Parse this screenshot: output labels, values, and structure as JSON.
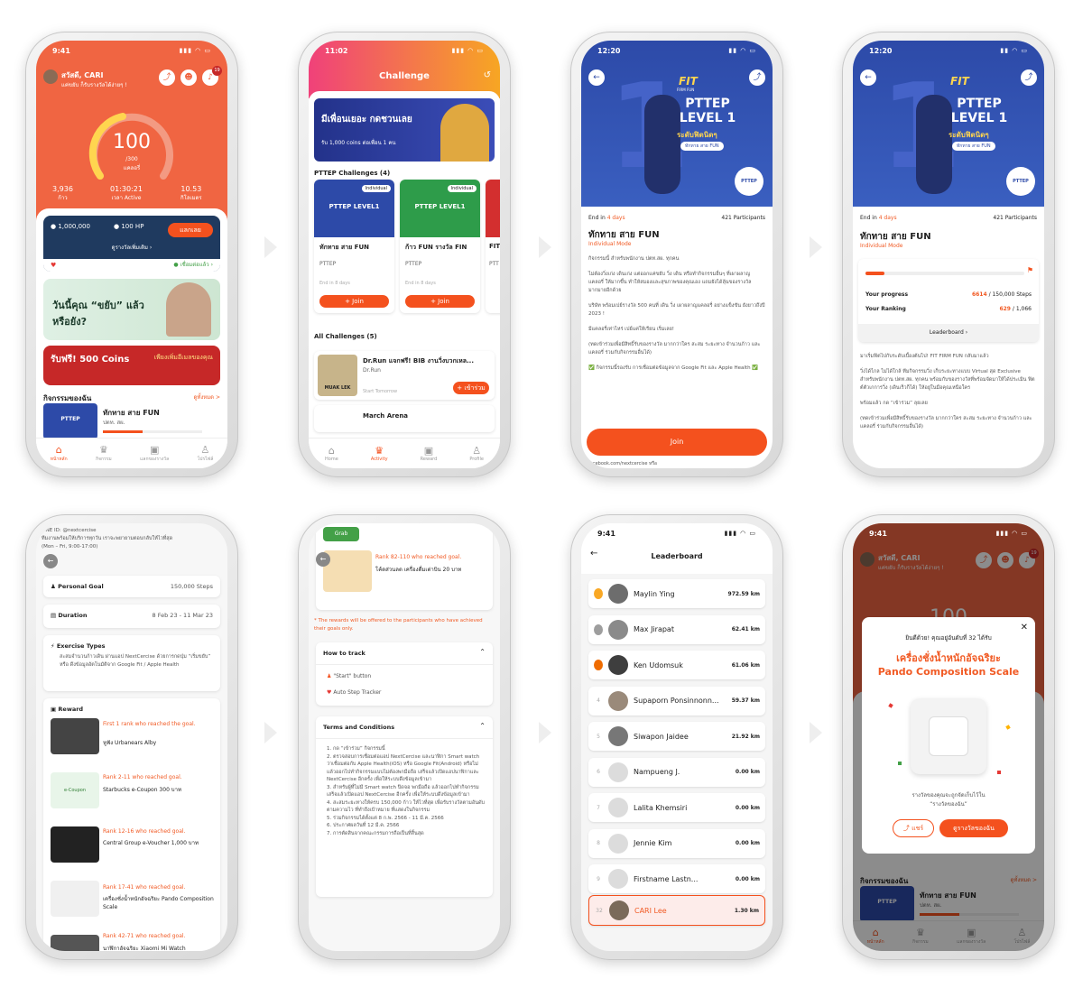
{
  "p1": {
    "time": "9:41",
    "greet": "สวัสดี, CARI",
    "sub": "แค่ขยับ ก็รับรางวัลได้ง่ายๆ !",
    "badge": "19",
    "kcal": "100",
    "kcal_of": "/300",
    "kcal_unit": "แคลอรี่",
    "steps": "3,936",
    "steps_l": "ก้าว",
    "active": "01:30:21",
    "active_l": "เวลา Active",
    "dist": "10.53",
    "dist_l": "กิโลเมตร",
    "coins": "1,000,000",
    "hp": "100 HP",
    "redeem": "แลกเลย",
    "reward_link": "ดูรางวัลเพิ่มเติม",
    "connected": "เชื่อมต่อแล้ว",
    "promo1": "วันนี้คุณ “ขยับ” แล้วหรือยัง?",
    "promo2": "รับฟรี! 500 Coins",
    "promo2b": "เพียงเพิ่มอีเมลของคุณ",
    "my_act": "กิจกรรมของฉัน",
    "see_all": "ดูทั้งหมด >",
    "act_title": "ทักทาย สาย FUN",
    "act_org": "ปตท. สผ.",
    "nav": [
      "หน้าหลัก",
      "กิจกรรม",
      "แลกของรางวัล",
      "โปรไฟล์"
    ]
  },
  "p2": {
    "time": "11:02",
    "title": "Challenge",
    "banner": "มีเพื่อนเยอะ กดชวนเลย",
    "banner_sub": "รับ 1,000 coins ต่อเพื่อน 1 คน",
    "pttep_ch": "PTTEP Challenges (4)",
    "c1": {
      "tag": "Individual",
      "title": "ทักทาย สาย FUN",
      "org": "PTTEP",
      "end": "End in 8 days",
      "btn": "+ Join"
    },
    "c2": {
      "tag": "Individual",
      "title": "ก้าว FUN รางวัล FIN",
      "org": "PTTEP",
      "end": "End in 8 days",
      "btn": "+ Join"
    },
    "c3": {
      "title": "FIT",
      "org": "PTT"
    },
    "all_ch": "All Challenges (5)",
    "a1": {
      "title": "Dr.Run แจกฟรี! BIB งานวิ่งบวกเหล...",
      "org": "Dr.Run",
      "when": "Start Tomorrow",
      "btn": "+ เข้าร่วม",
      "img": "MUAK LEK"
    },
    "a2": {
      "title": "March Arena"
    },
    "nav": [
      "Home",
      "Activity",
      "Reward",
      "Profile"
    ]
  },
  "p3": {
    "time": "12:20",
    "fit": "FIT",
    "fit_sub": "FIRM FUN",
    "level": "PTTEP LEVEL 1",
    "lv_th": "ระดับฟิตนิดๆ",
    "pill": "ทักทาย สาย FUN",
    "logo": "PTTEP",
    "end_pre": "End in",
    "end": "4 days",
    "parts": "421 Participants",
    "title": "ทักทาย สาย FUN",
    "mode": "Individual Mode",
    "body": [
      "กิจกรรมนี้ สำหรับพนักงาน ปตท.สผ. ทุกคน",
      "ไม่ต้องวิ่งเก่ง เดินเก่ง แต่ออกแค่ขยับ วิ่ง เดิน หรือทำกิจกรรมอื่นๆ ที่เผาผลาญแคลอรี่ ให้มากขึ้น ทำให้สมองและสุขภาพของคุณเอง แถมยังได้ลุ้นของรางวัลมากมายอีกด้วย",
      "บริษัท พร้อมเปย์รางวัล 500 คนที่ เดิน วิ่ง เผาผลาญแคลอรี่ อย่างแข็งขัน ยังยาวถึงปี 2023 !",
      "มีแคลอรี่เท่าไหร่ เปย์แค่ให้เรียน เริ่มเลย!",
      "(ทดเข้าร่วมเพื่อมีสิทธิ์รับของรางวัล มากกว่าใคร สะสม ระยะทาง จำนวนก้าว และแคลอรี่ ร่วมกับกิจกรรมอื่นได้)",
      "✅ กิจกรรมนี้รองรับ การเชื่อมต่อข้อมูลจาก Google Fit และ Apple Health ✅"
    ],
    "join": "Join",
    "foot": "facebook.com/nextcercise หรือ"
  },
  "p4": {
    "time": "12:20",
    "end_pre": "End in",
    "end": "4 days",
    "parts": "421 Participants",
    "title": "ทักทาย สาย FUN",
    "mode": "Individual Mode",
    "prog_l": "Your progress",
    "prog": "6614",
    "prog_of": "/ 150,000 Steps",
    "rank_l": "Your Ranking",
    "rank": "629",
    "rank_of": "/ 1,066",
    "lb": "Leaderboard",
    "body": [
      "มาเริ่มฟิตไปกับระดับเบื้องต้นไป! FIT FIRM FUN กลับมาแล้ว",
      "วิ่งได้ไกล ไม่ได้ใกล้ ทีมกิจกรรมวิ่ง เก็บระยะทางแบบ Virtual สุด Exclusive สำหรับพนักงาน ปตท.สผ. ทุกคน พร้อมกับของรางวัลที่พร้อมจัดมาให้ได้ประเมิน ฟิตต์ตัวเกการวิ่ง (เดินเร็วก็ได้) ให้อยู่ในมือคุณเหนือใคร",
      "พร้อมแล้ว กด “เข้าร่วม” ลุยเลย",
      "(ทดเข้าร่วมเพื่อมีสิทธิ์รับของรางวัล มากกว่าใคร สะสม ระยะทาง จำนวนก้าว และแคลอรี่ ร่วมกับกิจกรรมอื่นได้)"
    ]
  },
  "p5": {
    "top": [
      "LINE ID: @nextcercise",
      "ทีมงานพร้อมให้บริการทุกวัน เราจะพยายามตอบกลับให้ไวที่สุด",
      "(Mon – Fri, 9:00-17:00)"
    ],
    "goal_l": "Personal Goal",
    "goal": "150,000 Steps",
    "dur_l": "Duration",
    "dur": "8 Feb 23 - 11 Mar 23",
    "ex_l": "Exercise Types",
    "ex": "สะสมจำนวนก้าวเดิน ผ่านแอป NextCercise ด้วยการกดปุ่ม “เริ่มขยับ” หรือ ดึงข้อมูลอัตโนมัติจาก Google Fit / Apple Health",
    "rw_l": "Reward",
    "r1": {
      "rank": "First 1 rank who reached the goal.",
      "prize": "หูฟัง Urbanears Alby"
    },
    "r2": {
      "rank": "Rank 2-11 who reached goal.",
      "prize": "Starbucks e-Coupon 300 บาท",
      "img": "e-Coupon"
    },
    "r3": {
      "rank": "Rank 12-16 who reached goal.",
      "prize": "Central Group e-Voucher 1,000 บาท"
    },
    "r4": {
      "rank": "Rank 17-41 who reached goal.",
      "prize": "เครื่องชั่งน้ำหนักอัจฉริยะ Pando Composition Scale"
    },
    "r5": {
      "rank": "Rank 42-71 who reached goal.",
      "prize": "นาฬิกาอัจฉริยะ Xiaomi Mi Watch"
    }
  },
  "p6": {
    "grab": "Grab",
    "rank": "Rank 82-110 who reached goal.",
    "prize": "โค้ดส่วนลด เครื่องดื่มเต่าบิน 20 บาท",
    "note": "* The rewards will be offered to the participants who have achieved their goals only.",
    "how": "How to track",
    "h1": "\"Start\" button",
    "h2": "Auto Step Tracker",
    "terms": "Terms and Conditions",
    "tlist": [
      "1. กด “เข้าร่วม” กิจกรรมนี้",
      "2. ตรวจสอบการเชื่อมต่อแอป NextCercise และนาฬิกา Smart watch ว่าเชื่อมต่อกับ Apple Health(iOS) หรือ Google Fit(Android) หรือไม่ แล้วออกไปทำกิจกรรมแบบไม่ต้องพกมือถือ เสร็จแล้วเปิดแอปนาฬิกาและ NextCercise อีกครั้ง เพื่อให้ระบบดึงข้อมูลเข้ามา",
      "3. สำหรับผู้ที่ไม่มี Smart watch ปิดจอ พกมือถือ แล้วออกไปทำกิจกรรม เสร็จแล้วเปิดแอป NextCercise อีกครั้ง เพื่อให้ระบบดึงข้อมูลเข้ามา",
      "4. สะสมระยะทางให้ครบ 150,000 ก้าว ให้ไวที่สุด เพื่อรับรางวัลตามอันดับตามความไว ที่ทำถึงเป้าหมาย ที่แสดงในกิจกรรม",
      "5. ร่วมกิจกรรมได้ตั้งแต่ 8 ก.พ. 2566 - 11 มี.ค. 2566",
      "6. ประกาศผลวันที่ 12 มี.ค. 2566",
      "7. การตัดสินจากคณะกรรมการถือเป็นที่สิ้นสุด"
    ]
  },
  "p7": {
    "time": "9:41",
    "title": "Leaderboard",
    "rows": [
      {
        "rank": "1",
        "name": "Maylin Ying",
        "km": "972.59 km"
      },
      {
        "rank": "2",
        "name": "Max Jirapat",
        "km": "62.41 km"
      },
      {
        "rank": "3",
        "name": "Ken Udomsuk",
        "km": "61.06 km"
      },
      {
        "rank": "4",
        "name": "Supaporn Ponsinnonn...",
        "km": "59.37 km"
      },
      {
        "rank": "5",
        "name": "Siwapon Jaidee",
        "km": "21.92 km"
      },
      {
        "rank": "6",
        "name": "Nampueng J.",
        "km": "0.00 km"
      },
      {
        "rank": "7",
        "name": "Lalita Khemsiri",
        "km": "0.00 km"
      },
      {
        "rank": "8",
        "name": "Jennie Kim",
        "km": "0.00 km"
      },
      {
        "rank": "9",
        "name": "Firstname Lastn...",
        "km": "0.00 km"
      }
    ],
    "me": {
      "rank": "32",
      "name": "CARI Lee",
      "km": "1.30 km"
    }
  },
  "p8": {
    "time": "9:41",
    "greet": "สวัสดี, CARI",
    "sub": "แค่ขยับ ก็รับรางวัลได้ง่ายๆ !",
    "badge": "19",
    "kcal": "100",
    "m_top": "ยินดีด้วย! คุณอยู่อันดับที่ 32 ได้รับ",
    "m_title": "เครื่องชั่งน้ำหนักอัจฉริยะ",
    "m_title2": "Pando Composition Scale",
    "m_note": "รางวัลของคุณจะถูกจัดเก็บไว้ใน",
    "m_note2": "“รางวัลของฉัน”",
    "share": "แชร์",
    "view": "ดูรางวัลของฉัน",
    "my_act": "กิจกรรมของฉัน",
    "see_all": "ดูทั้งหมด >",
    "act_title": "ทักทาย สาย FUN",
    "act_org": "ปตท. สผ.",
    "nav": [
      "หน้าหลัก",
      "กิจกรรม",
      "แลกของรางวัล",
      "โปรไฟล์"
    ]
  },
  "colors": {
    "accent": "#f4511e",
    "header": "#f06542",
    "blue": "#2d4aa8"
  }
}
